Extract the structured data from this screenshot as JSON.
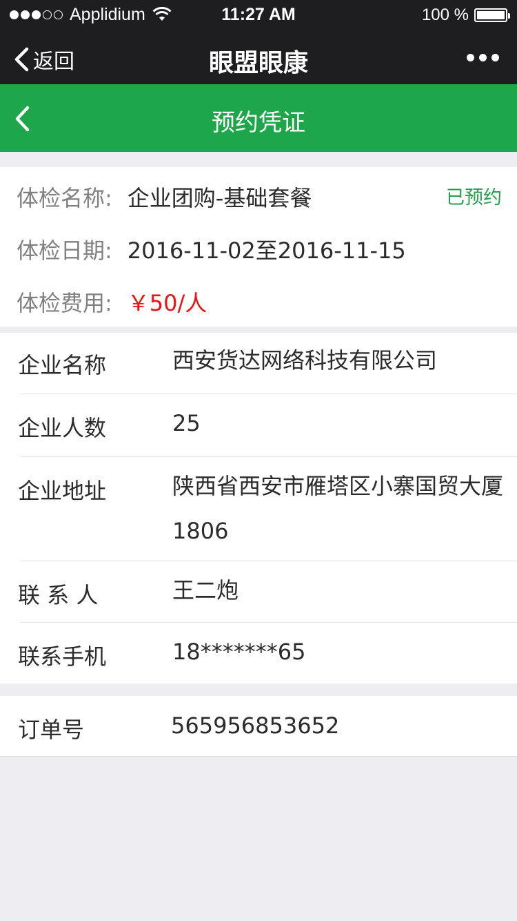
{
  "status_bar": {
    "carrier": "Applidium",
    "time": "11:27 AM",
    "battery": "100 %",
    "signal_bars_filled": 3,
    "signal_bars_total": 5
  },
  "nav": {
    "back_label": "返回",
    "title": "眼盟眼康"
  },
  "header": {
    "title": "预约凭证",
    "color": "#1ea64b"
  },
  "exam": {
    "name_label": "体检名称:",
    "name": "企业团购-基础套餐",
    "status": "已预约",
    "date_label": "体检日期:",
    "date": "2016-11-02至2016-11-15",
    "fee_label": "体检费用:",
    "fee": "￥50/人"
  },
  "company": {
    "name_label": "企业名称",
    "name": "西安货达网络科技有限公司",
    "headcount_label": "企业人数",
    "headcount": "25",
    "address_label": "企业地址",
    "address": "陕西省西安市雁塔区小寨国贸大厦1806",
    "contact_label": "联 系 人",
    "contact": "王二炮",
    "phone_label": "联系手机",
    "phone": "18*******65"
  },
  "order": {
    "label": "订单号",
    "number": "565956853652"
  }
}
